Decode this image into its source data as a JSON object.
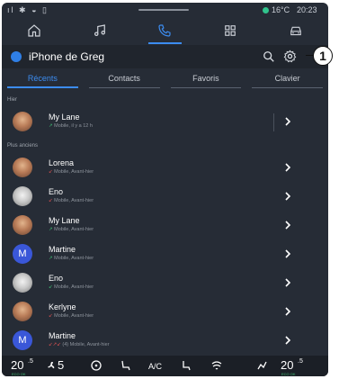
{
  "status_bar": {
    "icons": [
      "signal-icon",
      "bluetooth-icon",
      "wifi-icon",
      "phone-status-icon"
    ],
    "temperature": "16°C",
    "time": "20:23"
  },
  "top_nav": {
    "tabs": [
      {
        "icon": "home-icon",
        "active": false
      },
      {
        "icon": "music-icon",
        "active": false
      },
      {
        "icon": "phone-icon",
        "active": true
      },
      {
        "icon": "apps-grid-icon",
        "active": false
      },
      {
        "icon": "car-icon",
        "active": false
      }
    ]
  },
  "header": {
    "title": "iPhone de Greg",
    "icons": [
      "search-icon",
      "gear-icon"
    ]
  },
  "tabs": {
    "items": [
      "Récents",
      "Contacts",
      "Favoris",
      "Clavier"
    ],
    "active_index": 0
  },
  "sections": {
    "today": "Hier",
    "older": "Plus anciens"
  },
  "calls": [
    {
      "name": "My Lane",
      "detail": "Mobile, il y a 12 h",
      "direction": "outgoing",
      "avatar": "photo"
    },
    {
      "name": "Lorena",
      "detail": "Mobile, Avant-hier",
      "direction": "missed",
      "avatar": "photo"
    },
    {
      "name": "Eno",
      "detail": "Mobile, Avant-hier",
      "direction": "missed",
      "avatar": "bw"
    },
    {
      "name": "My Lane",
      "detail": "Mobile, Avant-hier",
      "direction": "outgoing",
      "avatar": "photo"
    },
    {
      "name": "Martine",
      "detail": "Mobile, Avant-hier",
      "direction": "outgoing",
      "avatar": "initial",
      "initial": "M"
    },
    {
      "name": "Eno",
      "detail": "Mobile, Avant-hier",
      "direction": "incoming",
      "avatar": "bw"
    },
    {
      "name": "Kerlyne",
      "detail": "Mobile, Avant-hier",
      "direction": "missed",
      "avatar": "photo"
    },
    {
      "name": "Martine",
      "detail": "(4) Mobile, Avant-hier",
      "direction": "missed",
      "avatar": "initial",
      "initial": "M"
    }
  ],
  "bottom_bar": {
    "left_temp": "20",
    "left_temp_small": ".5",
    "left_eco": "ECO OK",
    "fan_speed": "5",
    "ac_label": "A/C",
    "right_temp": "20",
    "right_temp_small": ".5",
    "right_eco": "ECO OK"
  },
  "callout_label": "1",
  "colors": {
    "background": "#262c36",
    "accent": "#3c8cf0",
    "missed": "#e05252",
    "outgoing": "#3fbf74",
    "avatar_initial": "#3a57d8"
  }
}
